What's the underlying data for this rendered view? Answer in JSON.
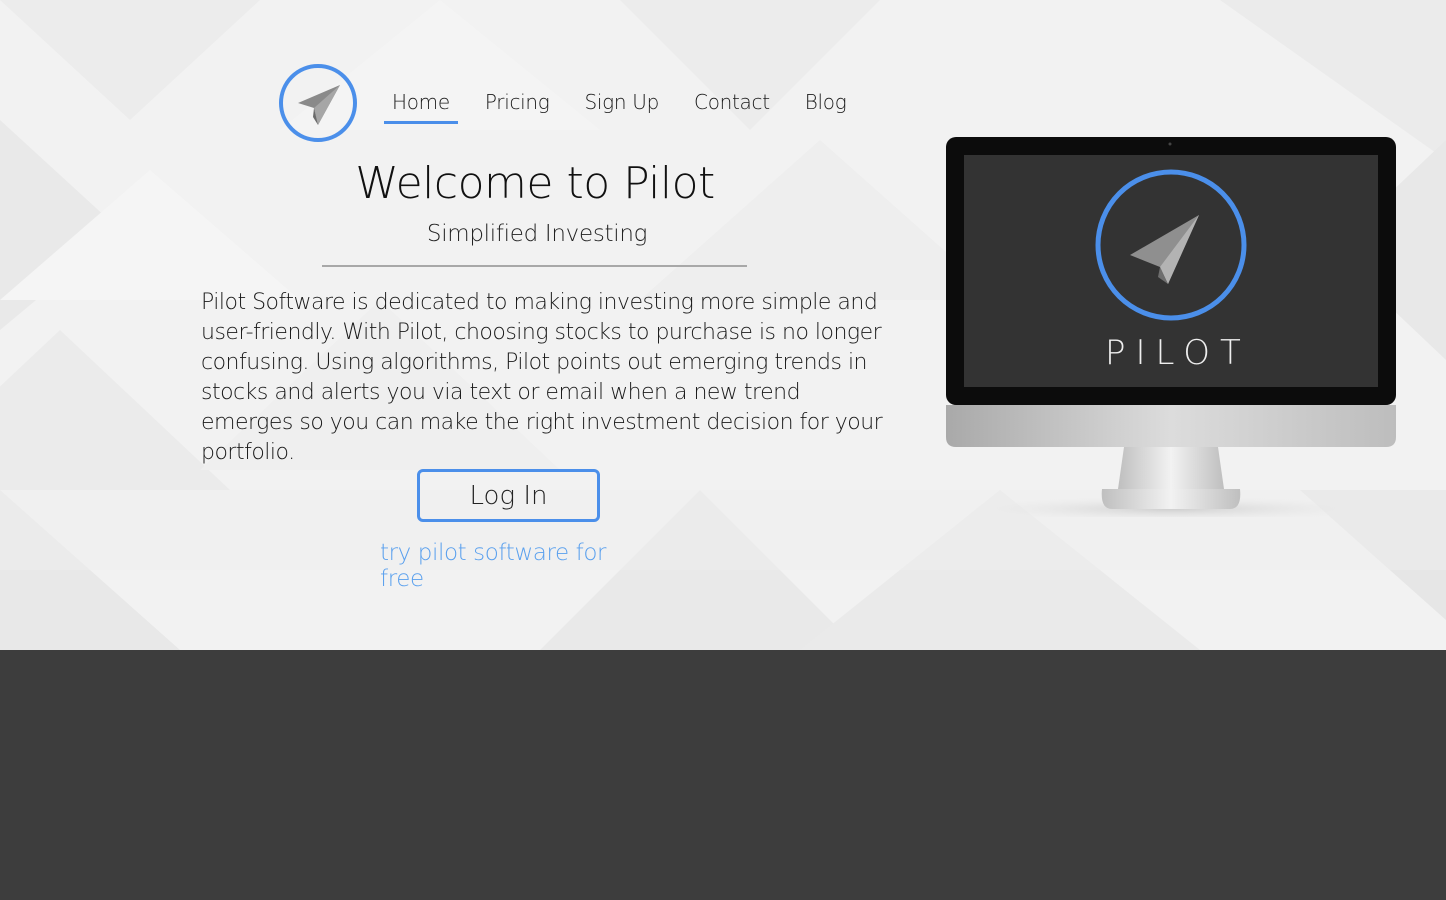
{
  "nav": {
    "items": [
      {
        "label": "Home",
        "active": true
      },
      {
        "label": "Pricing",
        "active": false
      },
      {
        "label": "Sign Up",
        "active": false
      },
      {
        "label": "Contact",
        "active": false
      },
      {
        "label": "Blog",
        "active": false
      }
    ]
  },
  "hero": {
    "title": "Welcome to Pilot",
    "subtitle": "Simplified Investing",
    "description": "Pilot Software is dedicated to making investing more simple and user-friendly. With Pilot, choosing stocks to purchase is no longer confusing. Using algorithms, Pilot points out emerging trends in stocks and alerts you via text or email when a new trend emerges so you can make the right investment decision for your portfolio.",
    "login_label": "Log In",
    "free_link": "try pilot software for free"
  },
  "monitor": {
    "screen_word": "PILOT"
  },
  "colors": {
    "accent": "#4b8fea",
    "link": "#5aa0ee",
    "hero_bg": "#f2f2f2",
    "footer_bg": "#3d3d3d",
    "screen_bg": "#333333"
  },
  "icons": {
    "logo": "paper-plane-icon",
    "screen_logo": "paper-plane-icon"
  }
}
